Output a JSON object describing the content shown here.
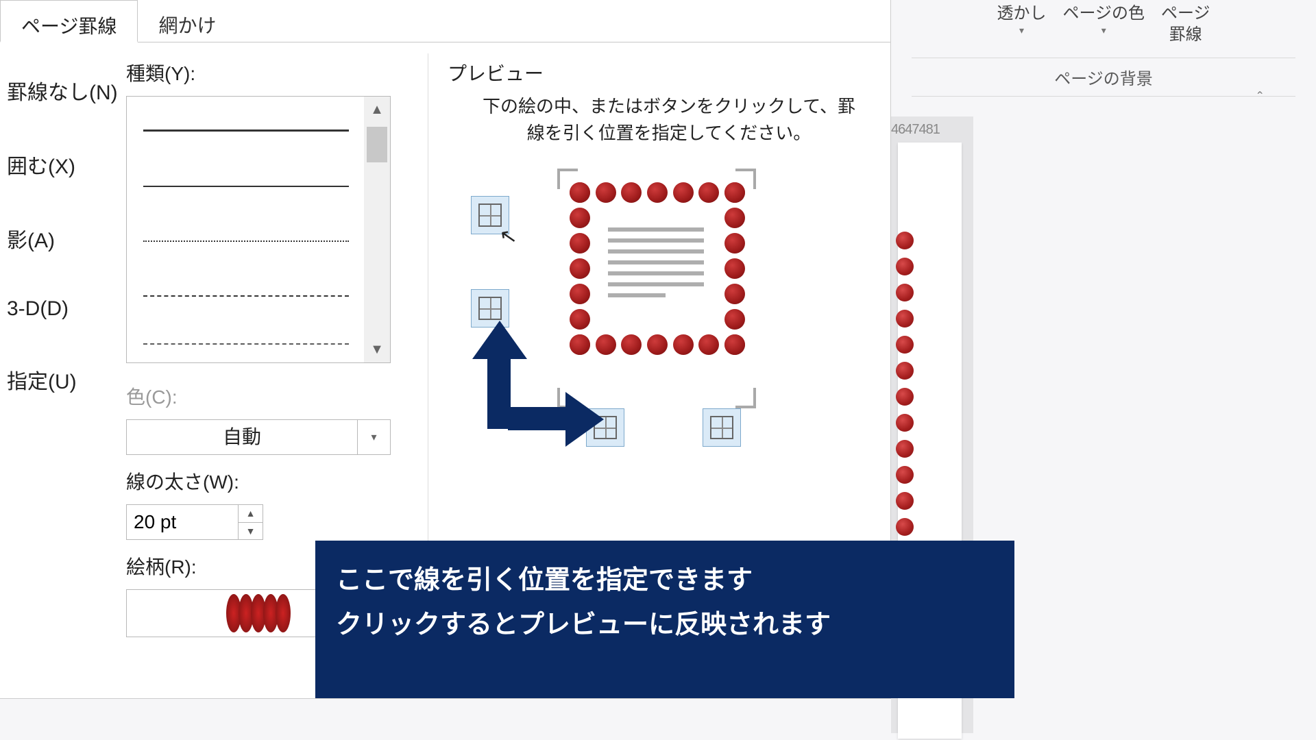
{
  "ribbon": {
    "watermark": "透かし",
    "page_color": "ページの色",
    "page_border": "ページ\n罫線",
    "group_label": "ページの背景",
    "ruler": "4647481"
  },
  "tabs": {
    "page_border": "ページ罫線",
    "shading": "網かけ"
  },
  "presets": {
    "none": "罫線なし(N)",
    "box": "囲む(X)",
    "shadow": "影(A)",
    "three_d": "3-D(D)",
    "custom": "指定(U)"
  },
  "mid": {
    "style_label": "種類(Y):",
    "color_label": "色(C):",
    "color_value": "自動",
    "width_label": "線の太さ(W):",
    "width_value": "20 pt",
    "art_label": "絵柄(R):"
  },
  "preview": {
    "title": "プレビュー",
    "hint": "下の絵の中、またはボタンをクリックして、罫線を引く位置を指定してください。"
  },
  "caption": {
    "line1": "ここで線を引く位置を指定できます",
    "line2": "クリックするとプレビューに反映されます"
  }
}
